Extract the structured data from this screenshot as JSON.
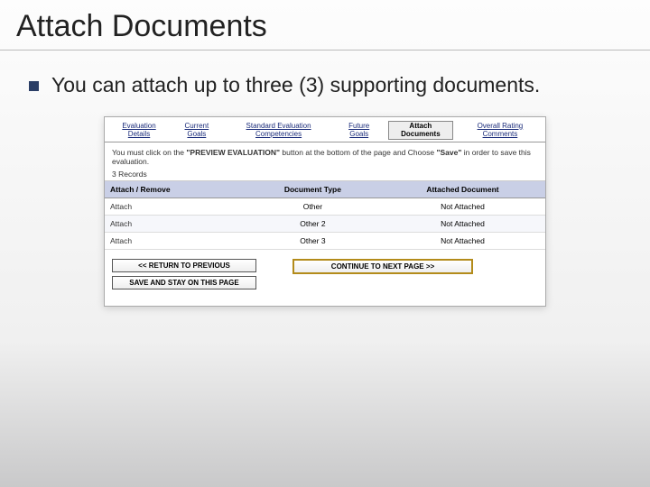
{
  "slide": {
    "title": "Attach Documents",
    "body_text": "You can attach up to three (3) supporting documents."
  },
  "ui": {
    "tabs": [
      {
        "label": "Evaluation Details"
      },
      {
        "label": "Current Goals"
      },
      {
        "label": "Standard Evaluation Competencies"
      },
      {
        "label": "Future Goals"
      },
      {
        "label": "Attach Documents"
      },
      {
        "label": "Overall Rating Comments"
      }
    ],
    "active_tab_index": 4,
    "instruction_prefix": "You must click on the ",
    "instruction_bold1": "\"PREVIEW EVALUATION\"",
    "instruction_mid": " button at the bottom of the page and Choose ",
    "instruction_bold2": "\"Save\"",
    "instruction_suffix": " in order to save this evaluation.",
    "records_label": "3 Records",
    "columns": {
      "c0": "Attach / Remove",
      "c1": "Document Type",
      "c2": "Attached Document"
    },
    "rows": [
      {
        "action": "Attach",
        "doctype": "Other",
        "attached": "Not Attached"
      },
      {
        "action": "Attach",
        "doctype": "Other 2",
        "attached": "Not Attached"
      },
      {
        "action": "Attach",
        "doctype": "Other 3",
        "attached": "Not Attached"
      }
    ],
    "buttons": {
      "return": "<< RETURN TO PREVIOUS",
      "save": "SAVE AND STAY ON THIS PAGE",
      "continue": "CONTINUE TO NEXT PAGE >>"
    }
  }
}
